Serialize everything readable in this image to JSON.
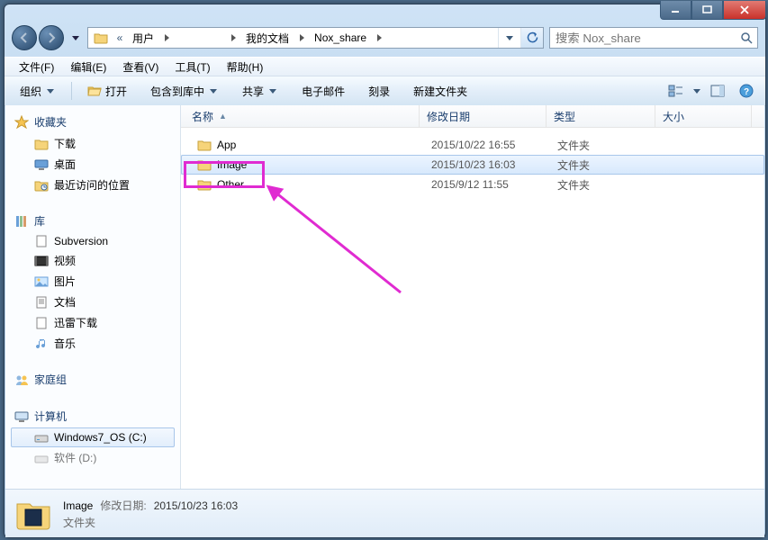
{
  "breadcrumb": {
    "items": [
      "用户",
      "",
      "我的文档",
      "Nox_share"
    ]
  },
  "search": {
    "placeholder": "搜索 Nox_share"
  },
  "menu": {
    "file": "文件(F)",
    "edit": "编辑(E)",
    "view": "查看(V)",
    "tools": "工具(T)",
    "help": "帮助(H)"
  },
  "toolbar": {
    "organize": "组织",
    "open": "打开",
    "include": "包含到库中",
    "share": "共享",
    "email": "电子邮件",
    "burn": "刻录",
    "newfolder": "新建文件夹"
  },
  "nav": {
    "favorites": {
      "label": "收藏夹",
      "items": [
        {
          "label": "下载"
        },
        {
          "label": "桌面"
        },
        {
          "label": "最近访问的位置"
        }
      ]
    },
    "libraries": {
      "label": "库",
      "items": [
        {
          "label": "Subversion"
        },
        {
          "label": "视频"
        },
        {
          "label": "图片"
        },
        {
          "label": "文档"
        },
        {
          "label": "迅雷下载"
        },
        {
          "label": "音乐"
        }
      ]
    },
    "homegroup": {
      "label": "家庭组"
    },
    "computer": {
      "label": "计算机",
      "items": [
        {
          "label": "Windows7_OS (C:)"
        },
        {
          "label": "软件 (D:)"
        }
      ]
    }
  },
  "columns": {
    "name": "名称",
    "date": "修改日期",
    "type": "类型",
    "size": "大小"
  },
  "rows": [
    {
      "name": "App",
      "date": "2015/10/22 16:55",
      "type": "文件夹",
      "size": ""
    },
    {
      "name": "Image",
      "date": "2015/10/23 16:03",
      "type": "文件夹",
      "size": ""
    },
    {
      "name": "Other",
      "date": "2015/9/12 11:55",
      "type": "文件夹",
      "size": ""
    }
  ],
  "details": {
    "name": "Image",
    "dateLabel": "修改日期:",
    "dateValue": "2015/10/23 16:03",
    "type": "文件夹"
  }
}
